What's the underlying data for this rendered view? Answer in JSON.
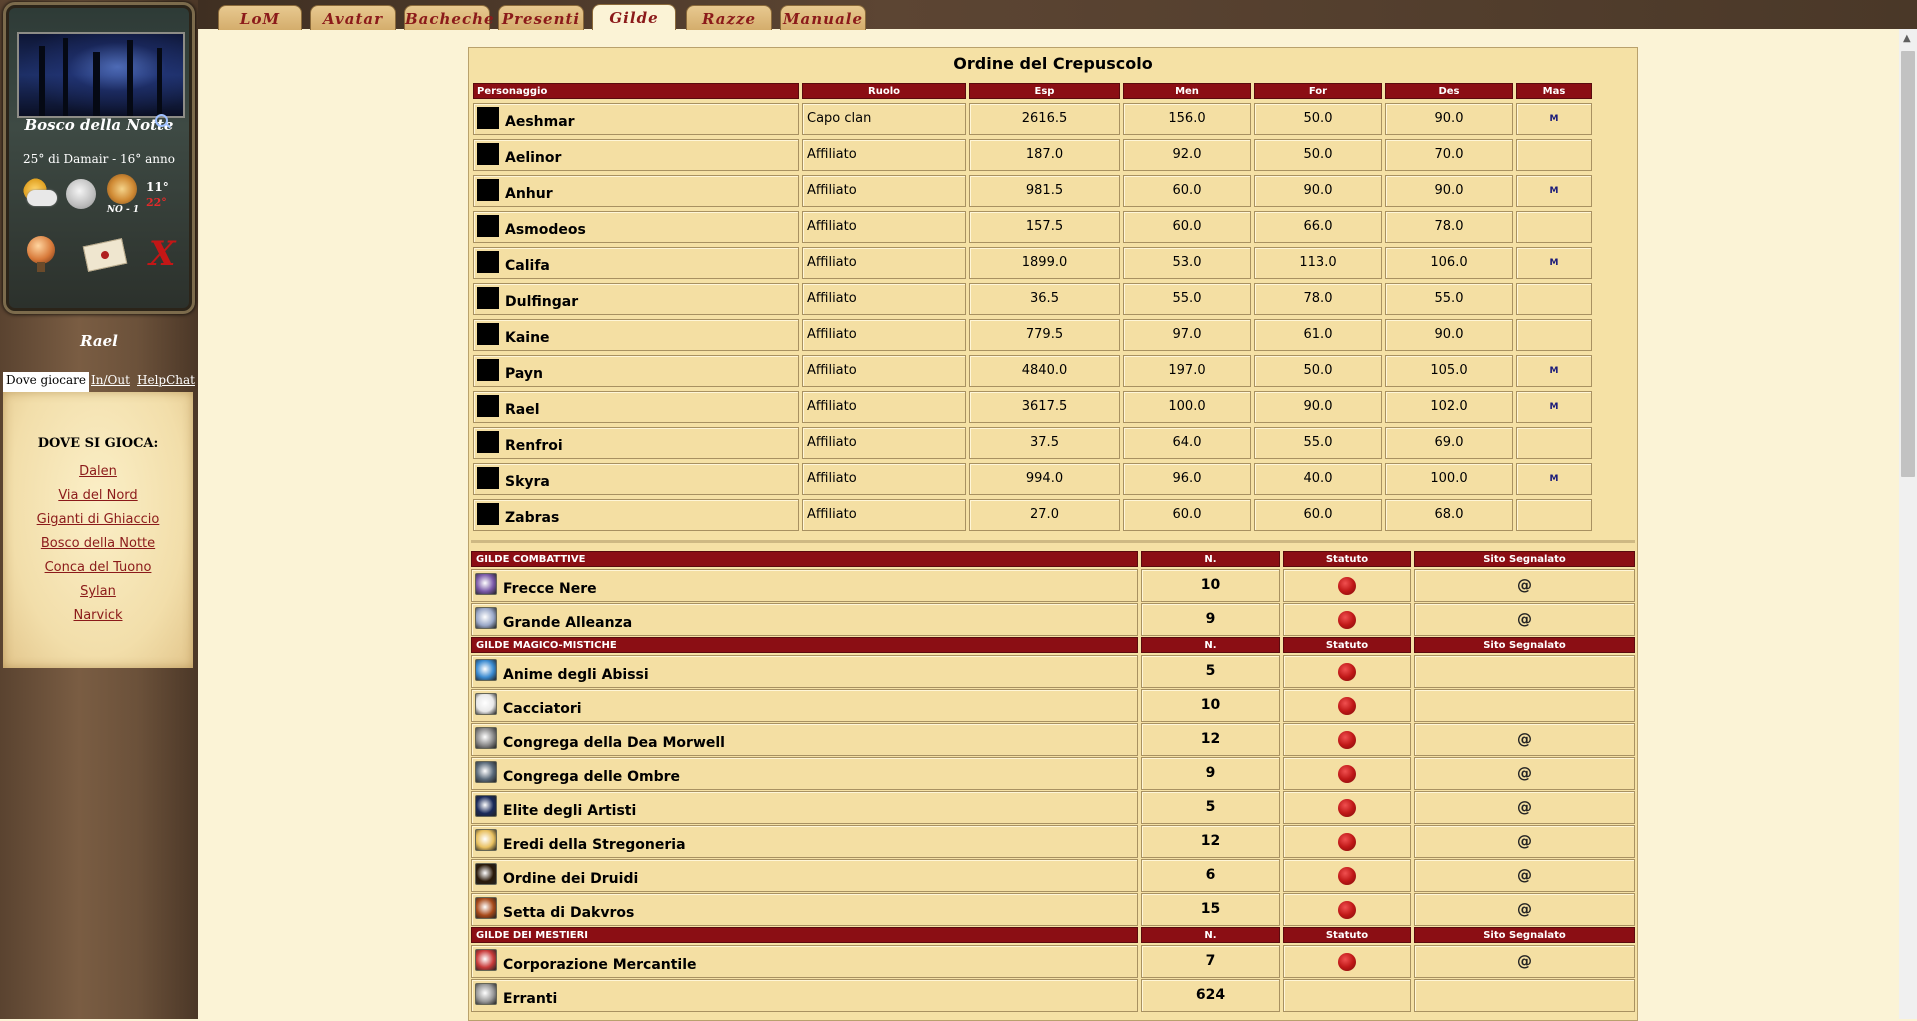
{
  "tabs": [
    {
      "label": "LoM",
      "active": false
    },
    {
      "label": "Avatar",
      "active": false
    },
    {
      "label": "Bacheche",
      "active": false
    },
    {
      "label": "Presenti",
      "active": false
    },
    {
      "label": "Gilde",
      "active": true
    },
    {
      "label": "Razze",
      "active": false
    },
    {
      "label": "Manuale",
      "active": false
    }
  ],
  "sidebar": {
    "location_name": "Bosco della Notte",
    "date": "25° di Damair - 16° anno",
    "wind": "NO - 1",
    "temp_high": "11°",
    "temp_low": "22°",
    "username": "Rael",
    "tabs": {
      "where": "Dove giocare",
      "inout": "In/Out",
      "helpchat": "HelpChat"
    },
    "where_title": "DOVE SI GIOCA:",
    "places": [
      "Dalen",
      "Via del Nord",
      "Giganti di Ghiaccio",
      "Bosco della Notte",
      "Conca del Tuono",
      "Sylan",
      "Narvick"
    ]
  },
  "guild": {
    "title": "Ordine del Crepuscolo",
    "columns": [
      "Personaggio",
      "Ruolo",
      "Esp",
      "Men",
      "For",
      "Des",
      "Mas"
    ],
    "members": [
      {
        "name": "Aeshmar",
        "role": "Capo clan",
        "esp": "2616.5",
        "men": "156.0",
        "for": "50.0",
        "des": "90.0",
        "mas": "M"
      },
      {
        "name": "Aelinor",
        "role": "Affiliato",
        "esp": "187.0",
        "men": "92.0",
        "for": "50.0",
        "des": "70.0",
        "mas": ""
      },
      {
        "name": "Anhur",
        "role": "Affiliato",
        "esp": "981.5",
        "men": "60.0",
        "for": "90.0",
        "des": "90.0",
        "mas": "M"
      },
      {
        "name": "Asmodeos",
        "role": "Affiliato",
        "esp": "157.5",
        "men": "60.0",
        "for": "66.0",
        "des": "78.0",
        "mas": ""
      },
      {
        "name": "Califa",
        "role": "Affiliato",
        "esp": "1899.0",
        "men": "53.0",
        "for": "113.0",
        "des": "106.0",
        "mas": "M"
      },
      {
        "name": "Dulfingar",
        "role": "Affiliato",
        "esp": "36.5",
        "men": "55.0",
        "for": "78.0",
        "des": "55.0",
        "mas": ""
      },
      {
        "name": "Kaine",
        "role": "Affiliato",
        "esp": "779.5",
        "men": "97.0",
        "for": "61.0",
        "des": "90.0",
        "mas": ""
      },
      {
        "name": "Payn",
        "role": "Affiliato",
        "esp": "4840.0",
        "men": "197.0",
        "for": "50.0",
        "des": "105.0",
        "mas": "M"
      },
      {
        "name": "Rael",
        "role": "Affiliato",
        "esp": "3617.5",
        "men": "100.0",
        "for": "90.0",
        "des": "102.0",
        "mas": "M"
      },
      {
        "name": "Renfroi",
        "role": "Affiliato",
        "esp": "37.5",
        "men": "64.0",
        "for": "55.0",
        "des": "69.0",
        "mas": ""
      },
      {
        "name": "Skyra",
        "role": "Affiliato",
        "esp": "994.0",
        "men": "96.0",
        "for": "40.0",
        "des": "100.0",
        "mas": "M"
      },
      {
        "name": "Zabras",
        "role": "Affiliato",
        "esp": "27.0",
        "men": "60.0",
        "for": "60.0",
        "des": "68.0",
        "mas": ""
      }
    ]
  },
  "guild_columns": {
    "n": "N.",
    "statuto": "Statuto",
    "sito": "Sito Segnalato"
  },
  "guild_sections": [
    {
      "title": "GILDE COMBATTIVE",
      "guilds": [
        {
          "name": "Frecce Nere",
          "n": "10",
          "statuto": true,
          "sito": "@",
          "icon_color": "#7a5aa8"
        },
        {
          "name": "Grande Alleanza",
          "n": "9",
          "statuto": true,
          "sito": "@",
          "icon_color": "#9aa8c8"
        }
      ]
    },
    {
      "title": "GILDE MAGICO-MISTICHE",
      "guilds": [
        {
          "name": "Anime degli Abissi",
          "n": "5",
          "statuto": true,
          "sito": "",
          "icon_color": "#3a8ad0"
        },
        {
          "name": "Cacciatori",
          "n": "10",
          "statuto": true,
          "sito": "",
          "icon_color": "#e8e8e8"
        },
        {
          "name": "Congrega della Dea Morwell",
          "n": "12",
          "statuto": true,
          "sito": "@",
          "icon_color": "#8a8a8a"
        },
        {
          "name": "Congrega delle Ombre",
          "n": "9",
          "statuto": true,
          "sito": "@",
          "icon_color": "#5a6a7a"
        },
        {
          "name": "Elite degli Artisti",
          "n": "5",
          "statuto": true,
          "sito": "@",
          "icon_color": "#1a2a5a"
        },
        {
          "name": "Eredi della Stregoneria",
          "n": "12",
          "statuto": true,
          "sito": "@",
          "icon_color": "#e8c060"
        },
        {
          "name": "Ordine dei Druidi",
          "n": "6",
          "statuto": true,
          "sito": "@",
          "icon_color": "#2a1a0a"
        },
        {
          "name": "Setta di Dakvros",
          "n": "15",
          "statuto": true,
          "sito": "@",
          "icon_color": "#a84a1a"
        }
      ]
    },
    {
      "title": "GILDE DEI MESTIERI",
      "guilds": [
        {
          "name": "Corporazione Mercantile",
          "n": "7",
          "statuto": true,
          "sito": "@",
          "icon_color": "#c83a3a"
        },
        {
          "name": "Erranti",
          "n": "624",
          "statuto": false,
          "sito": "",
          "icon_color": "#9a9a9a"
        }
      ]
    }
  ]
}
